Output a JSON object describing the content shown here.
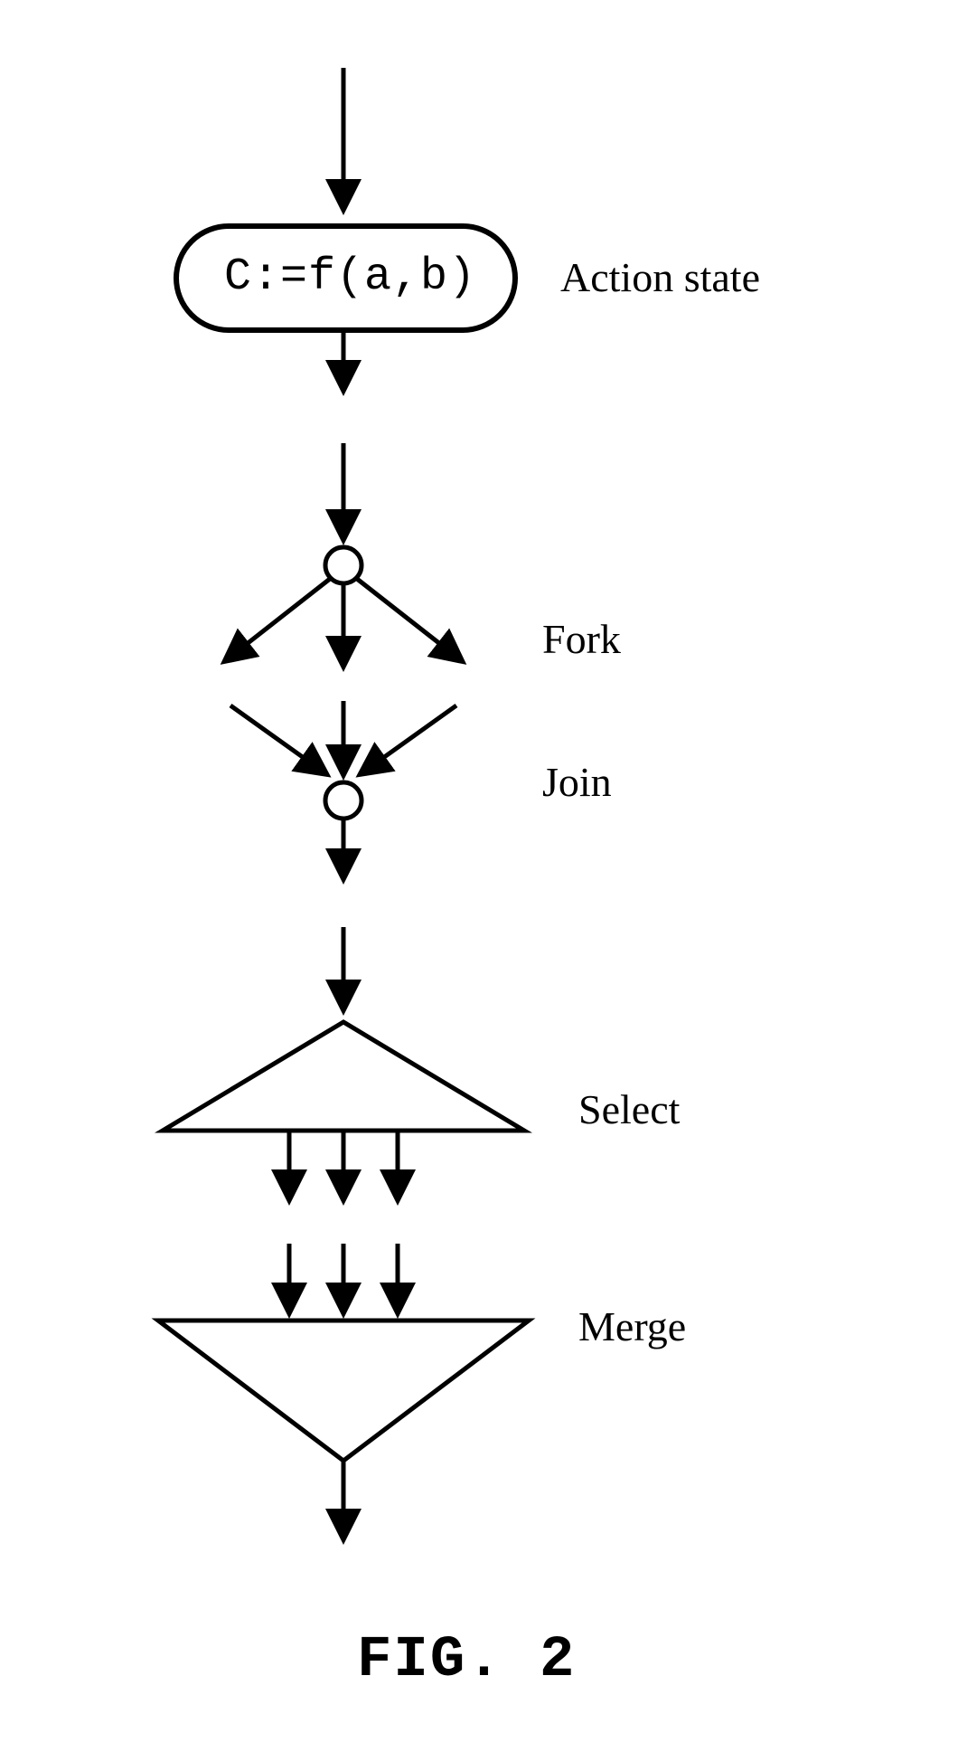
{
  "action_state": {
    "text": "C:=f(a,b)",
    "label": "Action state"
  },
  "fork": {
    "label": "Fork"
  },
  "join": {
    "label": "Join"
  },
  "select": {
    "label": "Select"
  },
  "merge": {
    "label": "Merge"
  },
  "figure_caption": "FIG. 2"
}
